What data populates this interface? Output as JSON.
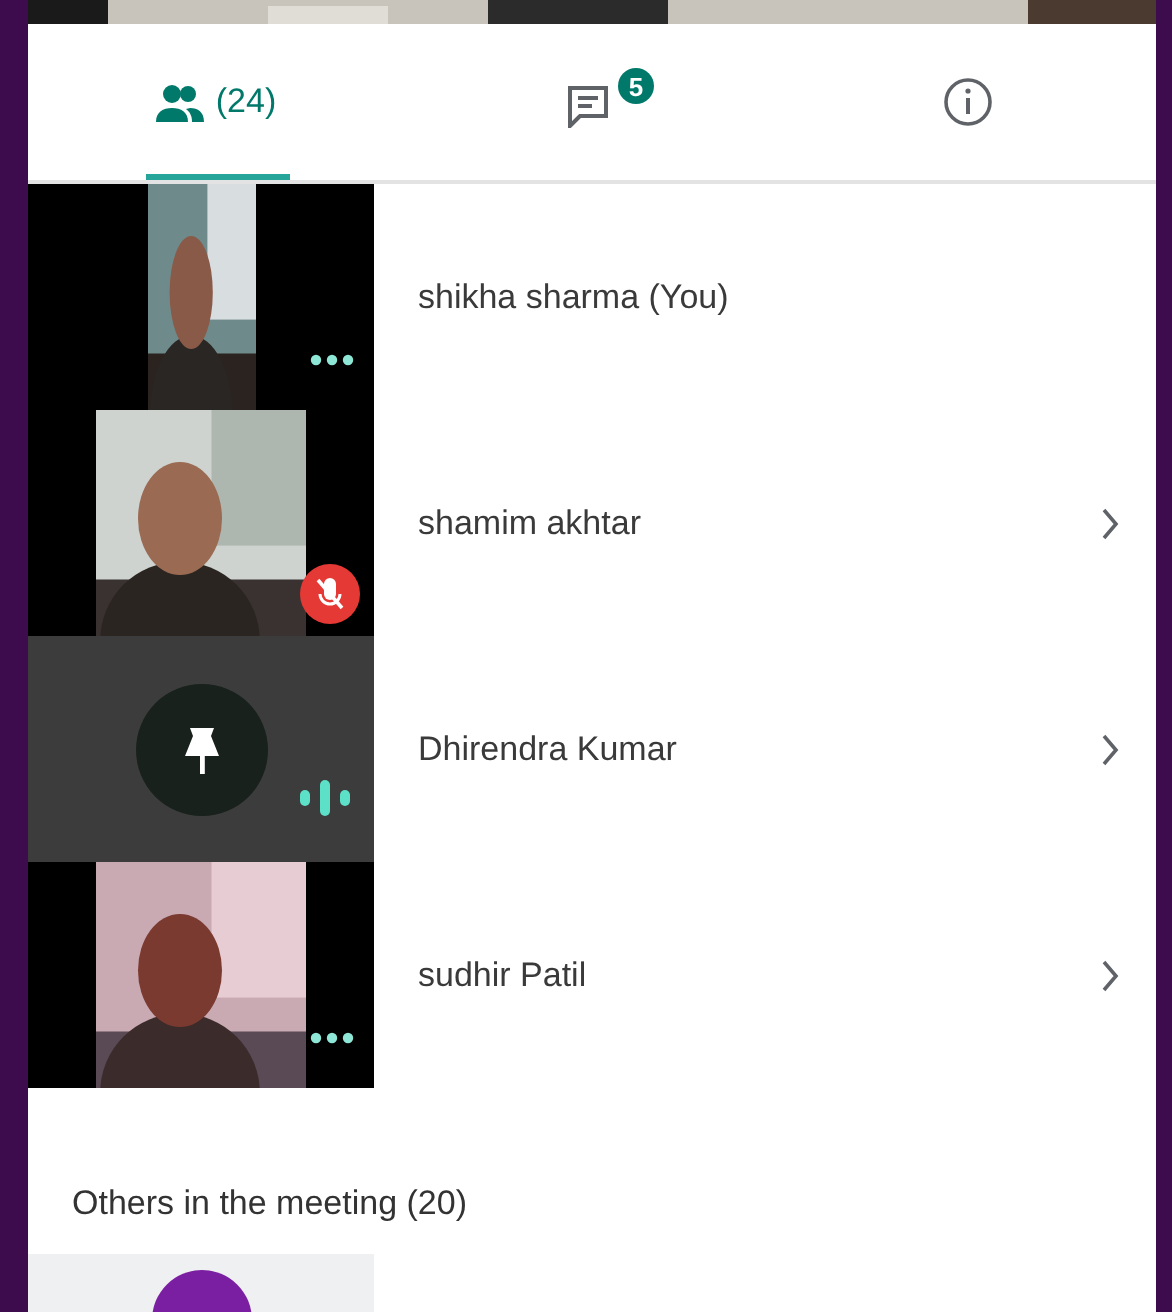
{
  "tabs": [
    {
      "kind": "people",
      "label": "(24)",
      "selected": true
    },
    {
      "kind": "chat",
      "badge": "5",
      "selected": false
    },
    {
      "kind": "info",
      "selected": false
    }
  ],
  "participants": [
    {
      "name": "shikha sharma (You)",
      "kind": "portrait",
      "muted": false,
      "speaking": false,
      "chevron": false
    },
    {
      "name": "shamim akhtar",
      "kind": "video",
      "muted": true,
      "speaking": false,
      "chevron": true
    },
    {
      "name": "Dhirendra Kumar",
      "kind": "pinned",
      "muted": false,
      "speaking": true,
      "chevron": true
    },
    {
      "name": "sudhir Patil",
      "kind": "video",
      "muted": false,
      "speaking": false,
      "chevron": true
    }
  ],
  "others": {
    "heading": "Others in the meeting (20)",
    "participants": [
      {
        "kind": "avatar"
      }
    ]
  }
}
